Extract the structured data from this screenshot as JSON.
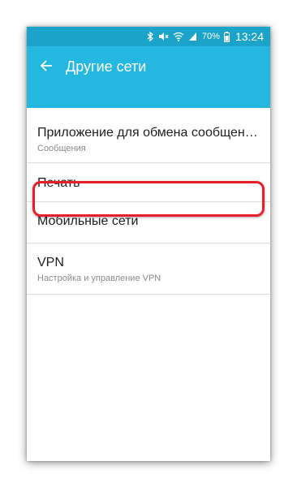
{
  "status_bar": {
    "battery_percent": "70%",
    "time": "13:24"
  },
  "app_bar": {
    "title": "Другие сети",
    "back_icon": "arrow-back-icon"
  },
  "list": {
    "items": [
      {
        "title": "Приложение для обмена сообщения...",
        "subtitle": "Сообщения"
      },
      {
        "title": "Печать"
      },
      {
        "title": "Мобильные сети"
      },
      {
        "title": "VPN",
        "subtitle": "Настройка и управление VPN"
      }
    ]
  },
  "colors": {
    "status_bar": "#1ca3c9",
    "app_bar": "#24b8e1",
    "highlight": "#e6202a"
  }
}
